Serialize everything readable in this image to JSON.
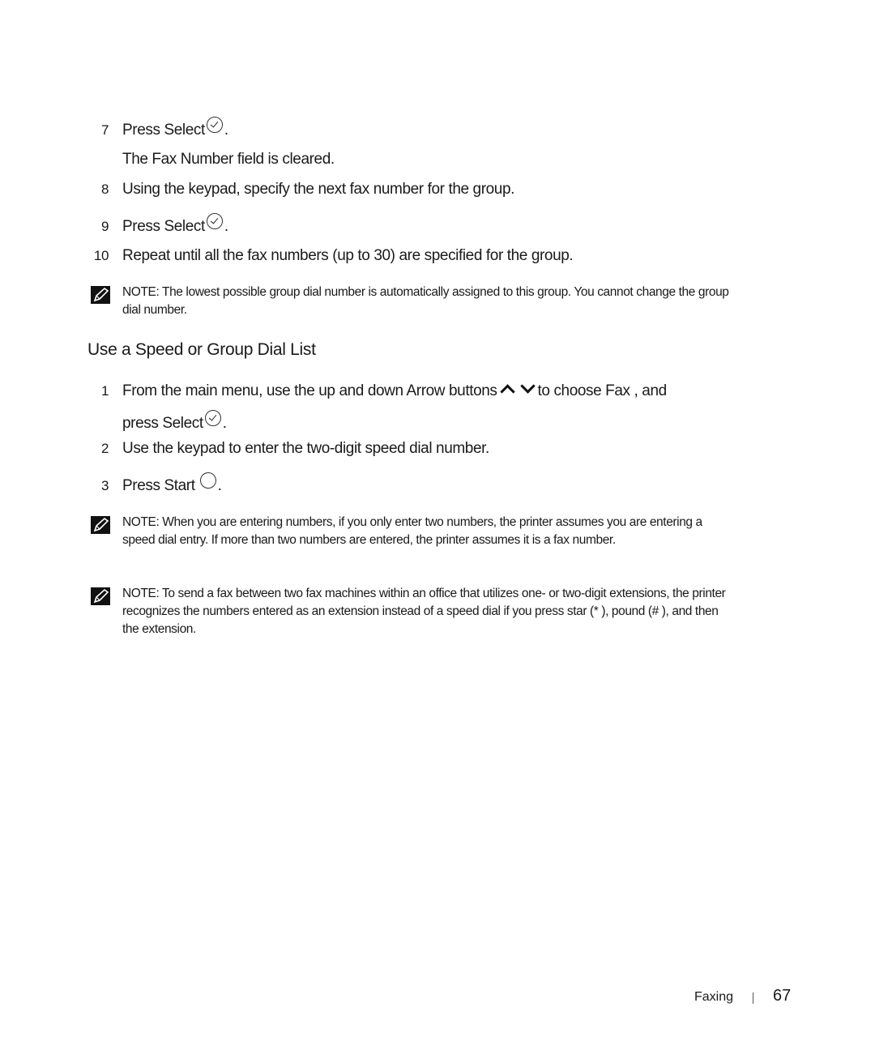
{
  "steps_top": [
    {
      "number": "7",
      "text_before": "Press Select",
      "icon": "select-check-icon",
      "text_after": "."
    },
    {
      "sub_text": "The Fax Number   field is cleared."
    },
    {
      "number": "8",
      "text": "Using the keypad, specify the next fax number for the group."
    },
    {
      "number": "9",
      "text_before": "Press Select",
      "icon": "select-check-icon",
      "text_after": "."
    },
    {
      "number": "10",
      "text": "Repeat until all the fax numbers (up to 30) are specified for the group."
    }
  ],
  "note1": {
    "label": "NOTE:",
    "text": "The lowest possible group dial number is automatically assigned to this group. You cannot change the group dial number."
  },
  "section_heading": "Use a Speed or Group Dial List",
  "steps_section": [
    {
      "number": "1",
      "text_before": "From the main menu, use the up and down Arrow buttons",
      "icons": [
        "arrow-up-icon",
        "arrow-down-icon"
      ],
      "text_middle": "to choose Fax , and",
      "line2_before": "press Select",
      "line2_after": "."
    },
    {
      "number": "2",
      "text": "Use the keypad to enter the two-digit speed dial number."
    },
    {
      "number": "3",
      "text_before": "Press Start",
      "icon": "start-circle-icon",
      "text_after": "."
    }
  ],
  "note2": {
    "label": "NOTE:",
    "text": "When you are entering numbers, if you only enter two numbers, the printer assumes you are entering a speed dial entry. If more than two numbers are entered, the printer assumes it is a fax number."
  },
  "note3": {
    "label": "NOTE:",
    "text": "To send a fax between two fax machines within an office that utilizes one- or two-digit extensions, the printer recognizes the numbers entered as an extension instead of a speed dial if you press star (* ), pound (# ), and then the extension."
  },
  "footer": {
    "section": "Faxing",
    "page_number": "67"
  }
}
